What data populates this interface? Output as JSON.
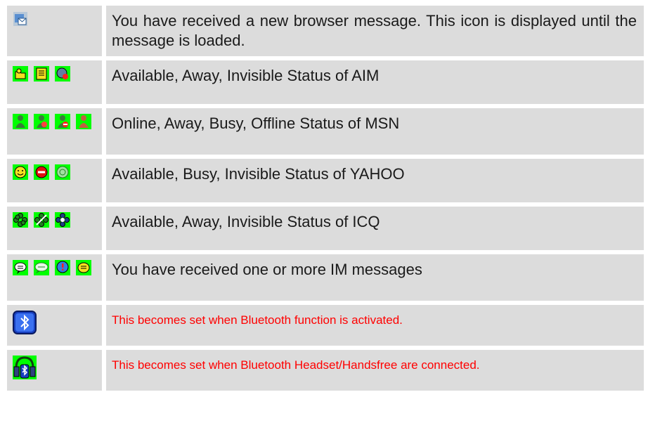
{
  "rows": [
    {
      "icons": [
        "browser-message-icon"
      ],
      "text": "You have received a new browser message. This icon is displayed until the message is loaded.",
      "style": "normal"
    },
    {
      "icons": [
        "aim-available-icon",
        "aim-away-icon",
        "aim-invisible-icon"
      ],
      "text": "Available, Away, Invisible Status of AIM",
      "style": "normal"
    },
    {
      "icons": [
        "msn-online-icon",
        "msn-away-icon",
        "msn-busy-icon",
        "msn-offline-icon"
      ],
      "text": "Online, Away, Busy, Offline Status of MSN",
      "style": "normal"
    },
    {
      "icons": [
        "yahoo-available-icon",
        "yahoo-busy-icon",
        "yahoo-invisible-icon"
      ],
      "text": "Available, Busy, Invisible Status of YAHOO",
      "style": "normal"
    },
    {
      "icons": [
        "icq-available-icon",
        "icq-away-icon",
        "icq-invisible-icon"
      ],
      "text": "Available, Away, Invisible Status of ICQ",
      "style": "normal"
    },
    {
      "icons": [
        "im-message-icon-1",
        "im-message-icon-2",
        "im-message-icon-3",
        "im-message-icon-4"
      ],
      "text": "You have received one or more IM messages",
      "style": "normal"
    },
    {
      "icons": [
        "bluetooth-icon"
      ],
      "text": "This becomes set when Bluetooth function is activated.",
      "style": "red"
    },
    {
      "icons": [
        "bluetooth-headset-icon"
      ],
      "text": "This becomes set when Bluetooth Headset/Handsfree are connected.",
      "style": "red"
    }
  ],
  "colors": {
    "cell_bg": "#dcdcdc",
    "highlight_green": "#00ff00",
    "alert_red": "#ff0000"
  }
}
